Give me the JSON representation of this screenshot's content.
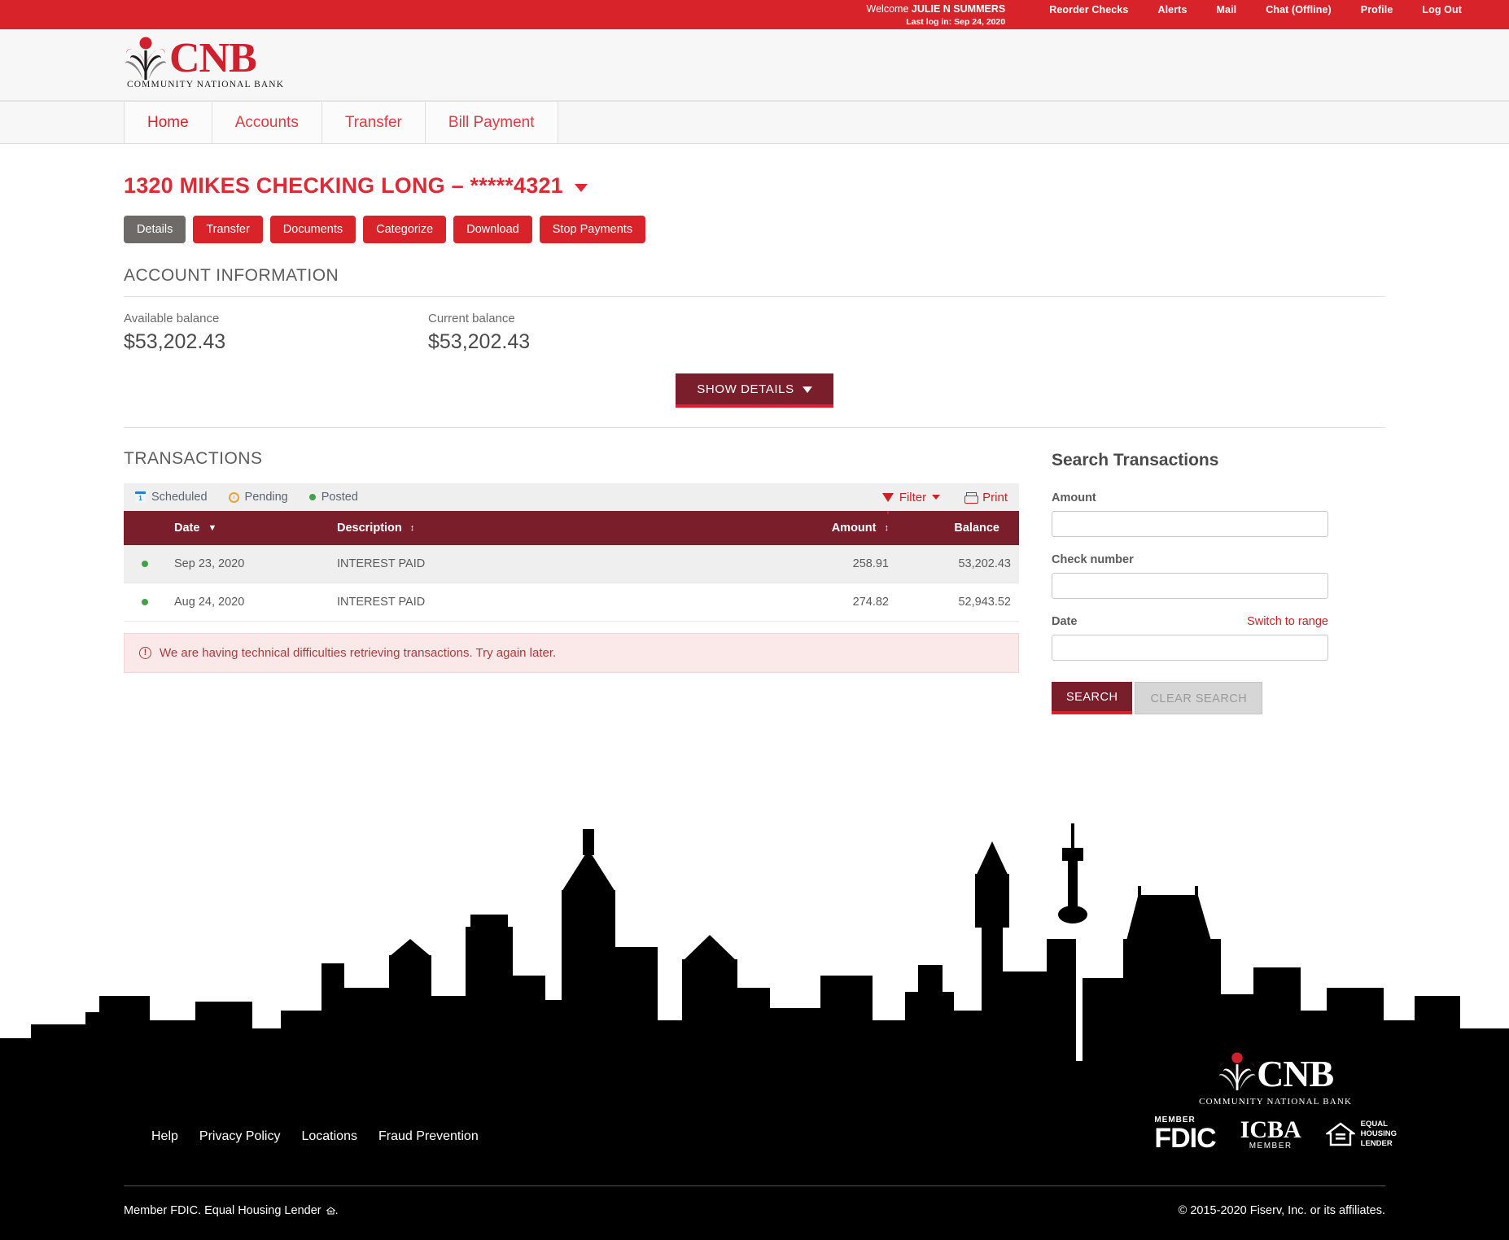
{
  "topbar": {
    "welcome_prefix": "Welcome",
    "user_name": "JULIE N SUMMERS",
    "last_login": "Last log in: Sep 24, 2020",
    "links": [
      {
        "label": "Reorder Checks"
      },
      {
        "label": "Alerts"
      },
      {
        "label": "Mail"
      },
      {
        "label": "Chat (Offline)"
      },
      {
        "label": "Profile"
      },
      {
        "label": "Log Out"
      }
    ]
  },
  "brand": {
    "name": "CNB",
    "tagline": "COMMUNITY NATIONAL BANK"
  },
  "mainnav": {
    "items": [
      {
        "label": "Home",
        "active": true
      },
      {
        "label": "Accounts",
        "active": false
      },
      {
        "label": "Transfer",
        "active": false
      },
      {
        "label": "Bill Payment",
        "active": false
      }
    ]
  },
  "account": {
    "title": "1320 MIKES CHECKING LONG – *****4321",
    "actions": [
      {
        "label": "Details",
        "style": "gray"
      },
      {
        "label": "Transfer",
        "style": "red"
      },
      {
        "label": "Documents",
        "style": "red"
      },
      {
        "label": "Categorize",
        "style": "red"
      },
      {
        "label": "Download",
        "style": "red"
      },
      {
        "label": "Stop Payments",
        "style": "red"
      }
    ],
    "info_heading": "ACCOUNT INFORMATION",
    "available_label": "Available balance",
    "available_value": "$53,202.43",
    "current_label": "Current balance",
    "current_value": "$53,202.43",
    "show_details_label": "SHOW DETAILS"
  },
  "transactions": {
    "heading": "TRANSACTIONS",
    "legend": [
      {
        "label": "Scheduled",
        "icon": "calendar-icon"
      },
      {
        "label": "Pending",
        "icon": "clock-icon"
      },
      {
        "label": "Posted",
        "icon": "green-dot-icon"
      }
    ],
    "filter_label": "Filter",
    "print_label": "Print",
    "columns": {
      "status": "",
      "date": "Date",
      "description": "Description",
      "amount": "Amount",
      "balance": "Balance"
    },
    "rows": [
      {
        "status": "posted",
        "date": "Sep 23, 2020",
        "description": "INTEREST PAID",
        "amount": "258.91",
        "balance": "53,202.43"
      },
      {
        "status": "posted",
        "date": "Aug 24, 2020",
        "description": "INTEREST PAID",
        "amount": "274.82",
        "balance": "52,943.52"
      }
    ],
    "error_message": "We are having technical difficulties retrieving transactions. Try again later."
  },
  "search": {
    "title": "Search Transactions",
    "amount_label": "Amount",
    "amount_value": "",
    "check_label": "Check number",
    "check_value": "",
    "date_label": "Date",
    "date_value": "",
    "switch_range_label": "Switch to range",
    "search_button": "SEARCH",
    "clear_button": "CLEAR SEARCH"
  },
  "footer": {
    "links": [
      {
        "label": "Help"
      },
      {
        "label": "Privacy Policy"
      },
      {
        "label": "Locations"
      },
      {
        "label": "Fraud Prevention"
      }
    ],
    "fdic_member": "MEMBER",
    "fdic_name": "FDIC",
    "icba_name": "ICBA",
    "icba_member": "MEMBER",
    "ehl_line1": "EQUAL",
    "ehl_line2": "HOUSING",
    "ehl_line3": "LENDER",
    "legal_left": "Member FDIC. Equal Housing Lender",
    "legal_left_suffix": ".",
    "legal_right": "© 2015-2020 Fiserv, Inc. or its affiliates."
  },
  "colors": {
    "brand_red": "#d8232a",
    "dark_maroon": "#7b1e2b",
    "link_red": "#cd2027",
    "posted_green": "#43a047",
    "pending_orange": "#e8a33d",
    "scheduled_blue": "#2b7fc4"
  }
}
